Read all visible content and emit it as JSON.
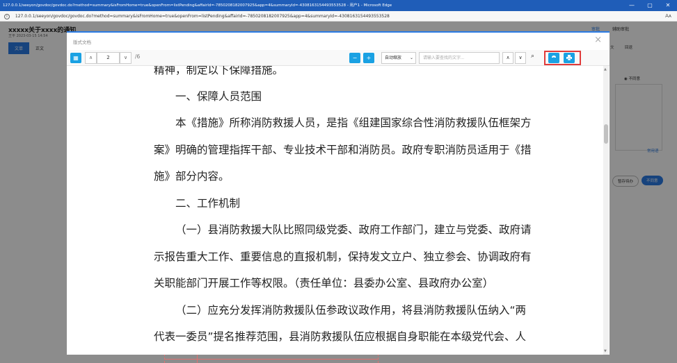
{
  "browser": {
    "title": "127.0.0.1/seeyon/govdoc/govdoc.do?method=summary&isFromHome=true&openFrom=listPending&affairId=-7850208182007925&app=4&summaryId=-4308163154493553528 - 用户1 - Microsoft Edge",
    "url": "127.0.0.1/seeyon/govdoc/govdoc.do?method=summary&isFromHome=true&openFrom=listPending&affairId=-7850208182007925&app=4&summaryId=-4308163154493553528",
    "reader_label": "Aᴀ",
    "min": "—",
    "max": "▢",
    "close": "✕"
  },
  "app": {
    "doc_title": "xxxxx关于xxxx的通知",
    "doc_meta": "王平 2023-03-15 14:54",
    "tabs": [
      "文单",
      "正文"
    ],
    "right_tabs": [
      "审批",
      "辅助审批"
    ],
    "right_mini": [
      "文",
      "回退"
    ],
    "radio_label": "◉ 不同意",
    "common_phrases": "常用语",
    "buttons": {
      "save": "暂存待办",
      "submit": "不同意"
    }
  },
  "modal": {
    "title": "版式文档",
    "close": "×",
    "toolbar": {
      "page_value": "2",
      "page_total": "/6",
      "zoom": "自动缩放",
      "search_placeholder": "请输入要查找的文字...",
      "prev": "∧",
      "next": "∨",
      "find_icon": "⌕",
      "thumb_icon": "▦",
      "up_icon": "∧",
      "down_icon": "∨",
      "zoom_out": "−",
      "zoom_in": "+"
    },
    "content": {
      "lines": [
        "精神，制定以下保障措施。",
        "一、保障人员范围",
        "本《措施》所称消防救援人员，是指《组建国家综合性消防救援队伍框架方",
        "案》明确的管理指挥干部、专业技术干部和消防员。政府专职消防员适用于《措",
        "施》部分内容。",
        "二、工作机制",
        "（一）县消防救援大队比照同级党委、政府工作部门，建立与党委、政府请",
        "示报告重大工作、重要信息的直报机制，保持发文立户、独立参会、协调政府有",
        "关职能部门开展工作等权限。（责任单位：县委办公室、县政府办公室）",
        "（二）应充分发挥消防救援队伍参政议政作用，将县消防救援队伍纳入“两",
        "代表一委员”提名推荐范围，县消防救援队伍应根据自身职能在本级党代会、人"
      ]
    }
  },
  "colors": {
    "accent": "#2a7be4",
    "toolbar_btn": "#1aa1e3",
    "highlight": "#e03a3a"
  }
}
